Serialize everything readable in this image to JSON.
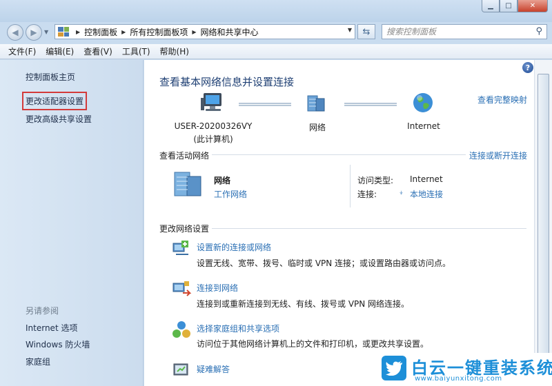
{
  "window": {
    "minimize_glyph": "▁",
    "maximize_glyph": "□",
    "close_glyph": "✕"
  },
  "nav": {
    "back_glyph": "◀",
    "forward_glyph": "▶",
    "breadcrumbs": [
      "控制面板",
      "所有控制面板项",
      "网络和共享中心"
    ],
    "search_placeholder": "搜索控制面板"
  },
  "menubar": {
    "items": [
      "文件(F)",
      "编辑(E)",
      "查看(V)",
      "工具(T)",
      "帮助(H)"
    ]
  },
  "sidebar": {
    "home": "控制面板主页",
    "adapter_settings": "更改适配器设置",
    "advanced_sharing": "更改高级共享设置",
    "see_also_heading": "另请参阅",
    "see_also": [
      "Internet 选项",
      "Windows 防火墙",
      "家庭组"
    ]
  },
  "main": {
    "title": "查看基本网络信息并设置连接",
    "full_map_link": "查看完整映射",
    "map": {
      "computer_name": "USER-20200326VY",
      "computer_sub": "(此计算机)",
      "network": "网络",
      "internet": "Internet"
    },
    "active": {
      "heading": "查看活动网络",
      "connect_link": "连接或断开连接",
      "network_name": "网络",
      "network_type": "工作网络",
      "access_type_label": "访问类型:",
      "access_type_value": "Internet",
      "connection_label": "连接:",
      "connection_value": "本地连接"
    },
    "change": {
      "heading": "更改网络设置",
      "tasks": [
        {
          "title": "设置新的连接或网络",
          "desc": "设置无线、宽带、拨号、临时或 VPN 连接；或设置路由器或访问点。",
          "icon": "new-connection-icon"
        },
        {
          "title": "连接到网络",
          "desc": "连接到或重新连接到无线、有线、拨号或 VPN 网络连接。",
          "icon": "connect-network-icon"
        },
        {
          "title": "选择家庭组和共享选项",
          "desc": "访问位于其他网络计算机上的文件和打印机，或更改共享设置。",
          "icon": "homegroup-icon"
        },
        {
          "title": "疑难解答",
          "desc": "",
          "icon": "troubleshoot-icon"
        }
      ]
    }
  },
  "watermark": {
    "title": "白云一键重装系统",
    "url": "www.baiyunxitong.com"
  },
  "colors": {
    "link": "#2a6fb4",
    "title": "#1e3f73",
    "highlight_box": "#d33a3a",
    "watermark": "#1d8fd8"
  }
}
